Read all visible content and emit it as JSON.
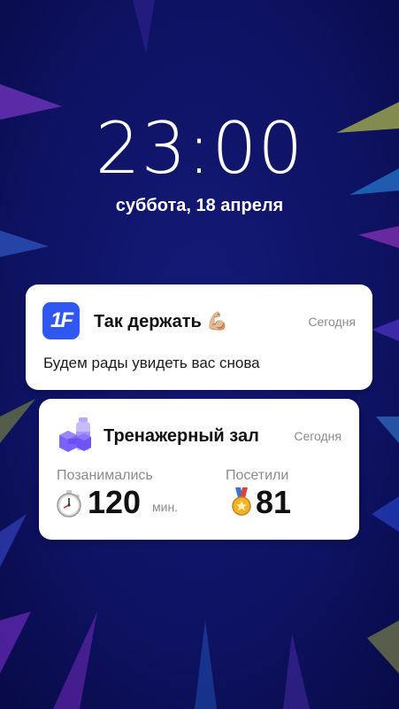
{
  "lockscreen": {
    "time": "23:00",
    "date": "суббота, 18 апреля"
  },
  "notifications": [
    {
      "app_icon": "1f-app-icon",
      "app_icon_text": "1F",
      "title": "Так держать 💪🏼",
      "time": "Сегодня",
      "body": "Будем рады увидеть вас снова"
    },
    {
      "app_icon": "gym-dumbbell-bottle-icon",
      "title": "Тренажерный зал",
      "time": "Сегодня",
      "stats": [
        {
          "label": "Позанимались",
          "icon": "stopwatch-icon",
          "value": "120",
          "unit": "мин."
        },
        {
          "label": "Посетили",
          "icon": "medal-icon",
          "value": "81"
        }
      ]
    }
  ],
  "colors": {
    "background": "#0d1160",
    "accent_blue": "#2f57f2",
    "gym_icon_purple": "#7b61ff"
  }
}
